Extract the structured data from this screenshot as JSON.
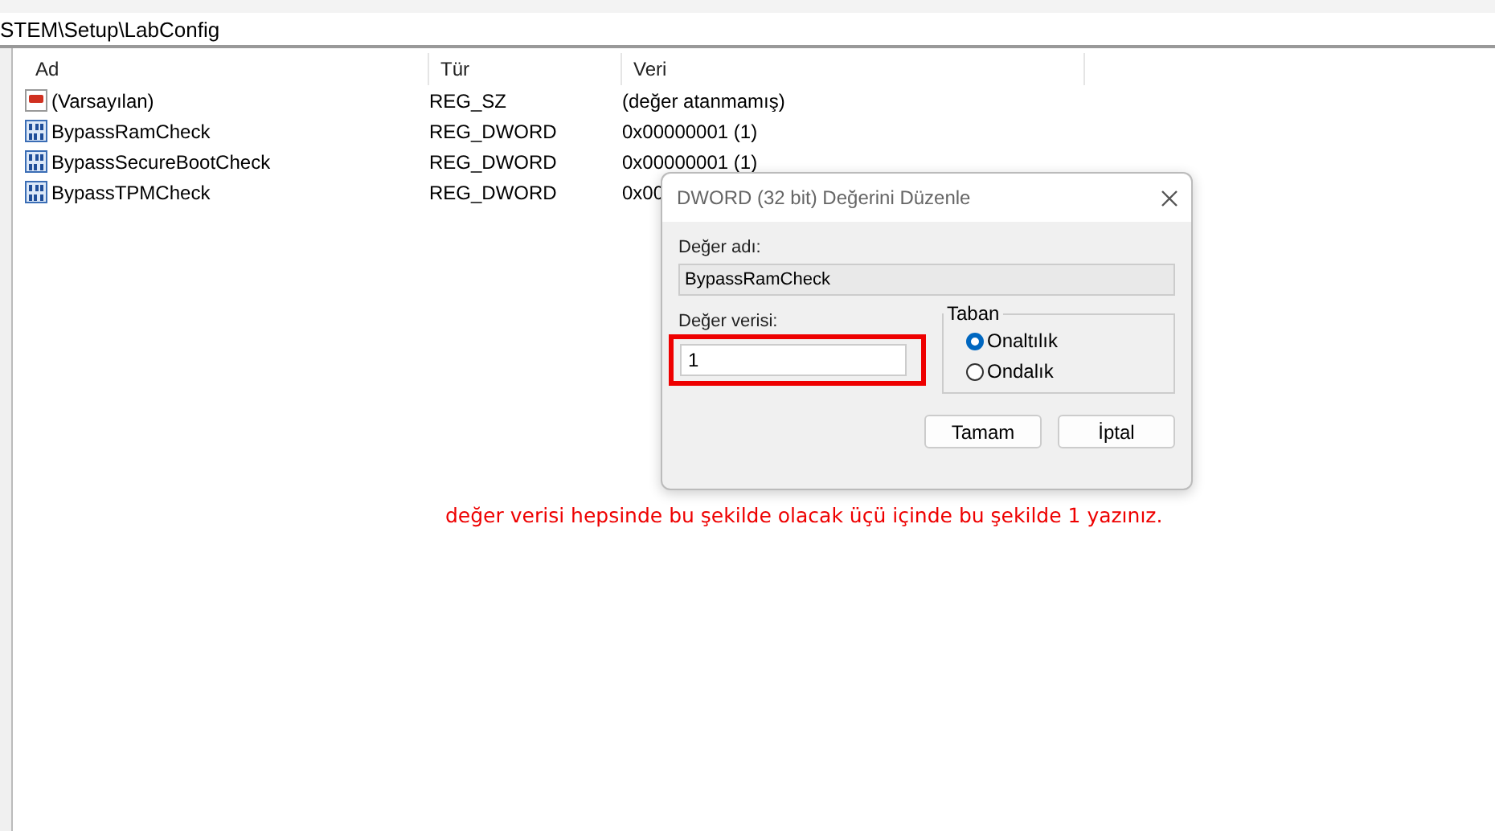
{
  "address_bar": {
    "path": "STEM\\Setup\\LabConfig"
  },
  "table": {
    "columns": [
      "Ad",
      "Tür",
      "Veri"
    ],
    "rows": [
      {
        "kind": "string",
        "name": "(Varsayılan)",
        "type": "REG_SZ",
        "data": "(değer atanmamış)"
      },
      {
        "kind": "binary",
        "name": "BypassRamCheck",
        "type": "REG_DWORD",
        "data": "0x00000001 (1)"
      },
      {
        "kind": "binary",
        "name": "BypassSecureBootCheck",
        "type": "REG_DWORD",
        "data": "0x00000001 (1)"
      },
      {
        "kind": "binary",
        "name": "BypassTPMCheck",
        "type": "REG_DWORD",
        "data": "0x00"
      }
    ]
  },
  "dialog": {
    "title": "DWORD (32 bit) Değerini Düzenle",
    "name_label": "Değer adı:",
    "name_value": "BypassRamCheck",
    "data_label": "Değer verisi:",
    "data_value": "1",
    "base_title": "Taban",
    "bases": [
      {
        "label": "Onaltılık",
        "selected": true
      },
      {
        "label": "Ondalık",
        "selected": false
      }
    ],
    "buttons": [
      "Tamam",
      "İptal"
    ]
  },
  "annotation": "değer verisi hepsinde bu şekilde olacak üçü içinde bu şekilde 1 yazınız."
}
